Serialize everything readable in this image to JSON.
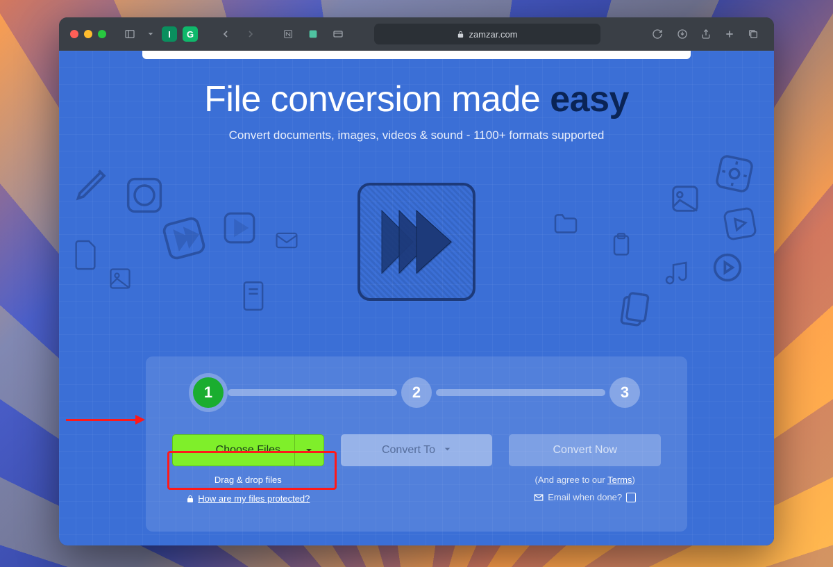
{
  "browser": {
    "url_host": "zamzar.com",
    "extensions": {
      "one": "I",
      "two": "G"
    }
  },
  "hero": {
    "title_prefix": "File conversion made ",
    "title_emphasis": "easy",
    "subtitle": "Convert documents, images, videos & sound - 1100+ formats supported"
  },
  "steps": {
    "s1": "1",
    "s2": "2",
    "s3": "3"
  },
  "actions": {
    "choose": "Choose Files",
    "convert_to": "Convert To",
    "convert_now": "Convert Now",
    "drag_hint": "Drag & drop files",
    "protected_link": "How are my files protected?",
    "agree_prefix": "(And agree to our ",
    "agree_link": "Terms",
    "agree_suffix": ")",
    "email_label": "Email when done?"
  }
}
